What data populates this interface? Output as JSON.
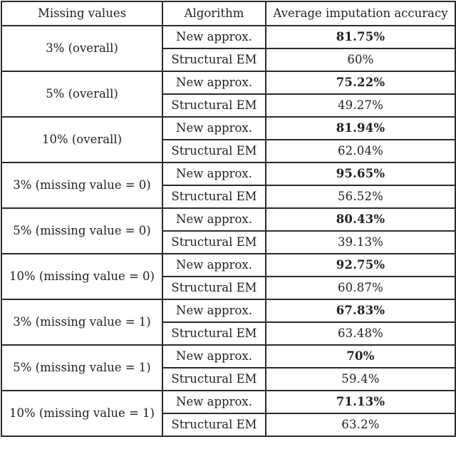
{
  "table": {
    "headers": [
      "Missing values",
      "Algorithm",
      "Average imputation accuracy"
    ],
    "groups": [
      {
        "missing": "3% (overall)",
        "rows": [
          {
            "algorithm": "New approx.",
            "accuracy": "81.75%",
            "best": true
          },
          {
            "algorithm": "Structural EM",
            "accuracy": "60%",
            "best": false
          }
        ]
      },
      {
        "missing": "5% (overall)",
        "rows": [
          {
            "algorithm": "New approx.",
            "accuracy": "75.22%",
            "best": true
          },
          {
            "algorithm": "Structural EM",
            "accuracy": "49.27%",
            "best": false
          }
        ]
      },
      {
        "missing": "10% (overall)",
        "rows": [
          {
            "algorithm": "New approx.",
            "accuracy": "81.94%",
            "best": true
          },
          {
            "algorithm": "Structural EM",
            "accuracy": "62.04%",
            "best": false
          }
        ]
      },
      {
        "missing": "3% (missing value = 0)",
        "rows": [
          {
            "algorithm": "New approx.",
            "accuracy": "95.65%",
            "best": true
          },
          {
            "algorithm": "Structural EM",
            "accuracy": "56.52%",
            "best": false
          }
        ]
      },
      {
        "missing": "5% (missing value = 0)",
        "rows": [
          {
            "algorithm": "New approx.",
            "accuracy": "80.43%",
            "best": true
          },
          {
            "algorithm": "Structural EM",
            "accuracy": "39.13%",
            "best": false
          }
        ]
      },
      {
        "missing": "10% (missing value = 0)",
        "rows": [
          {
            "algorithm": "New approx.",
            "accuracy": "92.75%",
            "best": true
          },
          {
            "algorithm": "Structural EM",
            "accuracy": "60.87%",
            "best": false
          }
        ]
      },
      {
        "missing": "3% (missing value = 1)",
        "rows": [
          {
            "algorithm": "New approx.",
            "accuracy": "67.83%",
            "best": true
          },
          {
            "algorithm": "Structural EM",
            "accuracy": "63.48%",
            "best": false
          }
        ]
      },
      {
        "missing": "5% (missing value = 1)",
        "rows": [
          {
            "algorithm": "New approx.",
            "accuracy": "70%",
            "best": true
          },
          {
            "algorithm": "Structural EM",
            "accuracy": "59.4%",
            "best": false
          }
        ]
      },
      {
        "missing": "10% (missing value = 1)",
        "rows": [
          {
            "algorithm": "New approx.",
            "accuracy": "71.13%",
            "best": true
          },
          {
            "algorithm": "Structural EM",
            "accuracy": "63.2%",
            "best": false
          }
        ]
      }
    ]
  }
}
